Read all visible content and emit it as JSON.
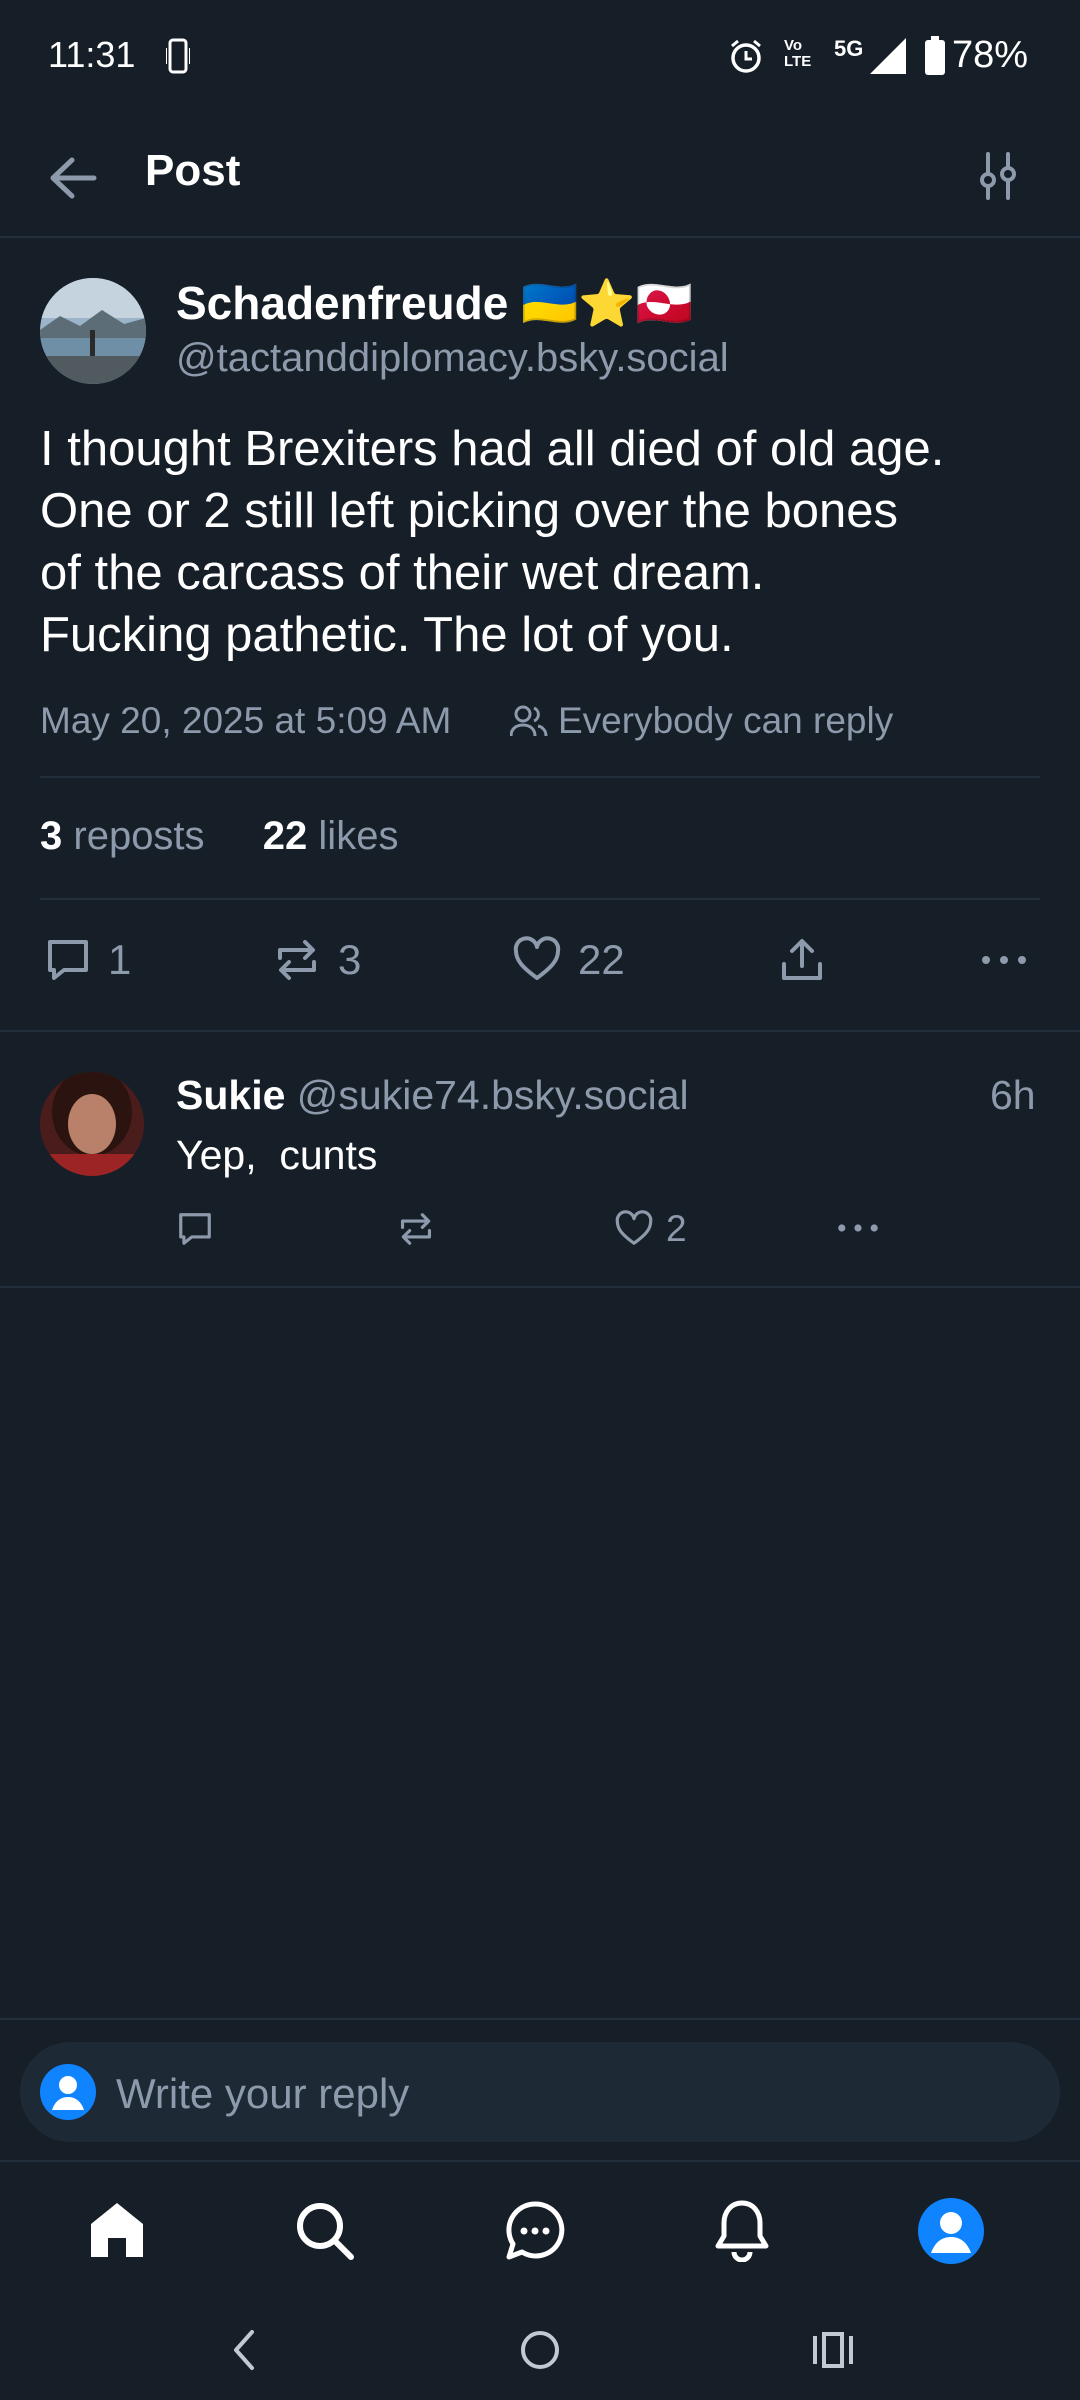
{
  "status_bar": {
    "time": "11:31",
    "battery": "78%",
    "network": "5G",
    "volte_label": "Vo LTE"
  },
  "header": {
    "title": "Post"
  },
  "post": {
    "author_name": "Schadenfreude 🇺🇦⭐🇬🇱",
    "author_handle": "@tactanddiplomacy.bsky.social",
    "text": "I thought Brexiters had all died of old age.\nOne or 2 still left picking over the bones\nof the carcass of their wet dream.\nFucking pathetic. The lot of you.",
    "timestamp": "May 20, 2025 at 5:09 AM",
    "reply_setting": "Everybody can reply",
    "reposts_count": "3",
    "reposts_label": "reposts",
    "likes_count": "22",
    "likes_label": "likes",
    "actions": {
      "reply_count": "1",
      "repost_count": "3",
      "like_count": "22"
    }
  },
  "reply": {
    "author_name": "Sukie",
    "author_handle": "@sukie74.bsky.social",
    "time": "6h",
    "text": "Yep,  cunts",
    "like_count": "2"
  },
  "compose": {
    "placeholder": "Write your reply"
  },
  "colors": {
    "background": "#161e27",
    "accent": "#1083fe",
    "muted": "#8d9aab",
    "divider": "#222e3b"
  }
}
